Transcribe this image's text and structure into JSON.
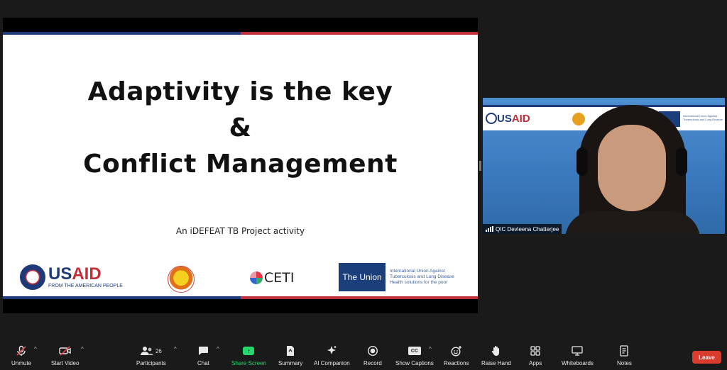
{
  "slide": {
    "title_line1": "Adaptivity is the key",
    "title_line2": "&",
    "title_line3": "Conflict Management",
    "subtitle": "An iDEFEAT TB Project activity",
    "logos": {
      "usaid_word_a": "US",
      "usaid_word_b": "AID",
      "usaid_tagline": "FROM THE AMERICAN PEOPLE",
      "ceti": "CETI",
      "union_box": "The Union",
      "union_text": "International Union Against Tuberculosis and Lung Disease",
      "union_tagline": "Health solutions for the poor"
    }
  },
  "participant": {
    "name": "QIC Devleena Chatterjee",
    "banner_usaid_a": "US",
    "banner_usaid_b": "AID",
    "banner_union_text": "International Union Against Tuberculosis and Lung Disease"
  },
  "toolbar": {
    "unmute": "Unmute",
    "start_video": "Start Video",
    "participants": "Participants",
    "participants_count": "26",
    "chat": "Chat",
    "share_screen": "Share Screen",
    "summary": "Summary",
    "ai_companion": "AI Companion",
    "record": "Record",
    "show_captions": "Show Captions",
    "reactions": "Reactions",
    "raise_hand": "Raise Hand",
    "apps": "Apps",
    "whiteboards": "Whiteboards",
    "notes": "Notes",
    "leave": "Leave",
    "cc_badge": "CC"
  },
  "colors": {
    "accent_green": "#23d96b",
    "leave_red": "#d93b2c",
    "usaid_blue": "#1f3a7a",
    "usaid_red": "#c0303a"
  }
}
